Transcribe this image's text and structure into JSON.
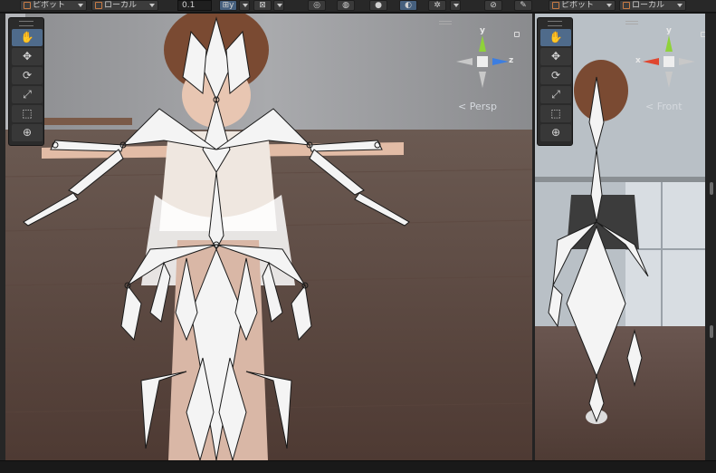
{
  "toolbar": {
    "pivot_left": "ピボット",
    "local_left": "ローカル",
    "snap_value": "0.1",
    "pivot_right": "ピボット",
    "local_right": "ローカル",
    "grid_snap_label": "⊞y",
    "increment_label": "⊠"
  },
  "tools": [
    {
      "name": "hand",
      "glyph": "✋",
      "active": true
    },
    {
      "name": "move",
      "glyph": "✥",
      "active": false
    },
    {
      "name": "rotate",
      "glyph": "⟳",
      "active": false
    },
    {
      "name": "scale",
      "glyph": "⤢",
      "active": false
    },
    {
      "name": "rect",
      "glyph": "⬚",
      "active": false
    },
    {
      "name": "transform",
      "glyph": "⊕",
      "active": false
    }
  ],
  "scene_left": {
    "gizmo_label": "< Persp",
    "axis_y": "y",
    "axis_z": "z"
  },
  "scene_right": {
    "gizmo_label": "< Front",
    "axis_y": "y",
    "axis_x": "x"
  },
  "colors": {
    "axis_y": "#8fd23a",
    "axis_x": "#e0462f",
    "axis_z": "#3d7ee0",
    "accent": "#4f6b8b"
  }
}
